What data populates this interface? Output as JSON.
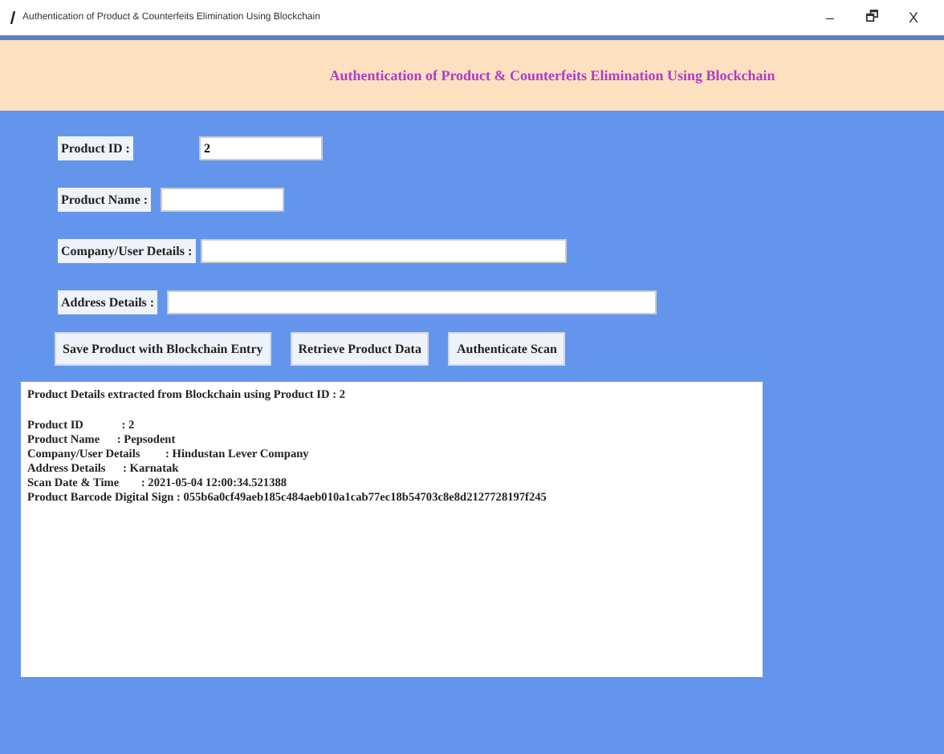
{
  "window": {
    "title": "Authentication of Product & Counterfeits Elimination Using Blockchain",
    "controls": [
      "–",
      "🗗",
      "X"
    ]
  },
  "header": {
    "title": "Authentication of Product & Counterfeits Elimination Using Blockchain"
  },
  "fields": [
    {
      "label": "Product ID :",
      "value": "2"
    },
    {
      "label": "Product Name :"
    },
    {
      "label": "Company/User Details :"
    },
    {
      "label": "Address Details :"
    }
  ],
  "buttons": [
    "Save Product with Blockchain Entry",
    "Retrieve Product Data",
    "Authenticate Scan"
  ],
  "output": {
    "heading": "Product Details extracted from Blockchain using Product ID : 2",
    "rows": [
      {
        "label": "Product ID",
        "value": ": 2"
      },
      {
        "label": "Product Name",
        "value": ": Pepsodent"
      },
      {
        "label": "Company/User Details",
        "value": ": Hindustan Lever Company"
      },
      {
        "label": "Address Details",
        "value": ": Karnatak"
      },
      {
        "label": "Scan Date & Time",
        "value": ": 2021-05-04 12:00:34.521388"
      },
      {
        "label": "Product Barcode Digital Sign",
        "value": ": 055b6a0cf49aeb185c484aeb010a1cab77ec18b54703c8e8d2127728197f245"
      }
    ]
  }
}
